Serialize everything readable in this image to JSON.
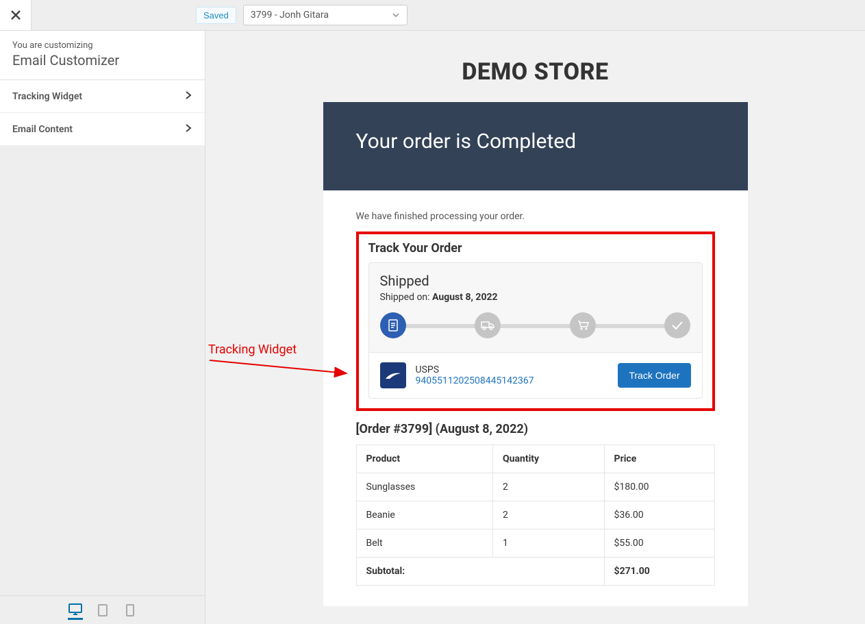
{
  "topbar": {
    "saved_label": "Saved",
    "order_select_value": "3799 - Jonh Gitara"
  },
  "sidebar": {
    "you_are": "You are customizing",
    "title": "Email Customizer",
    "items": [
      {
        "label": "Tracking Widget"
      },
      {
        "label": "Email Content"
      }
    ]
  },
  "annotation": {
    "label": "Tracking Widget"
  },
  "preview": {
    "store_name": "DEMO STORE",
    "header_title": "Your order is Completed",
    "processed_msg": "We have finished processing your order.",
    "track_heading": "Track Your Order",
    "shipped_status": "Shipped",
    "shipped_on_label": "Shipped on: ",
    "shipped_on_date": "August 8, 2022",
    "carrier": {
      "name": "USPS",
      "tracking_number": "940551120250844514​2367"
    },
    "track_button": "Track Order",
    "order_line": "[Order #3799] (August 8, 2022)",
    "columns": {
      "product": "Product",
      "qty": "Quantity",
      "price": "Price"
    },
    "items": [
      {
        "product": "Sunglasses",
        "qty": "2",
        "price": "$180.00"
      },
      {
        "product": "Beanie",
        "qty": "2",
        "price": "$36.00"
      },
      {
        "product": "Belt",
        "qty": "1",
        "price": "$55.00"
      }
    ],
    "subtotal_label": "Subtotal:",
    "subtotal_value": "$271.00"
  }
}
